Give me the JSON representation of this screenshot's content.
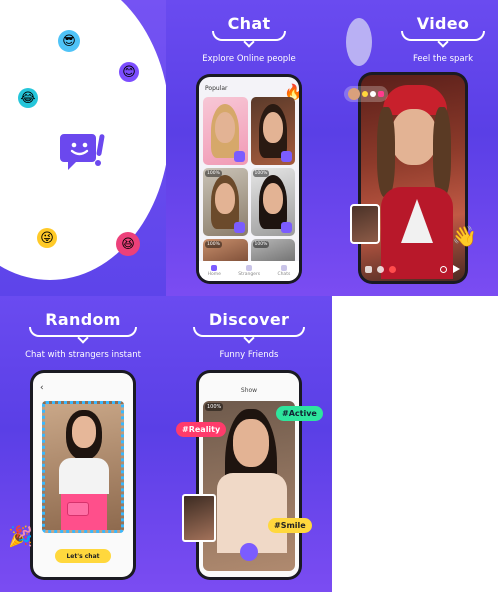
{
  "panels": {
    "intro": {
      "emojis": [
        "sunglasses-emoji",
        "smile-emoji",
        "laugh-emoji",
        "wink-emoji",
        "grin-emoji"
      ],
      "logo_color": "#6b48ee"
    },
    "chat": {
      "title": "Chat",
      "subtitle": "Explore Online people",
      "screen_header": "Popular",
      "online_badge": "100%",
      "tabs": [
        "Home",
        "Strangers",
        "Chats"
      ]
    },
    "video": {
      "title": "Video",
      "subtitle": "Feel the spark"
    },
    "random": {
      "title": "Random",
      "subtitle": "Chat with strangers instant",
      "button": "Let's chat"
    },
    "discover": {
      "title": "Discover",
      "subtitle": "Funny Friends",
      "screen_header": "Show",
      "badge": "100%",
      "tags": [
        "#Reality",
        "#Active",
        "#Smile"
      ]
    }
  },
  "colors": {
    "brand_purple": "#6a4bf0",
    "accent_yellow": "#ffd83d",
    "tag_red": "#ff3b6b",
    "tag_green": "#2ee59d"
  }
}
